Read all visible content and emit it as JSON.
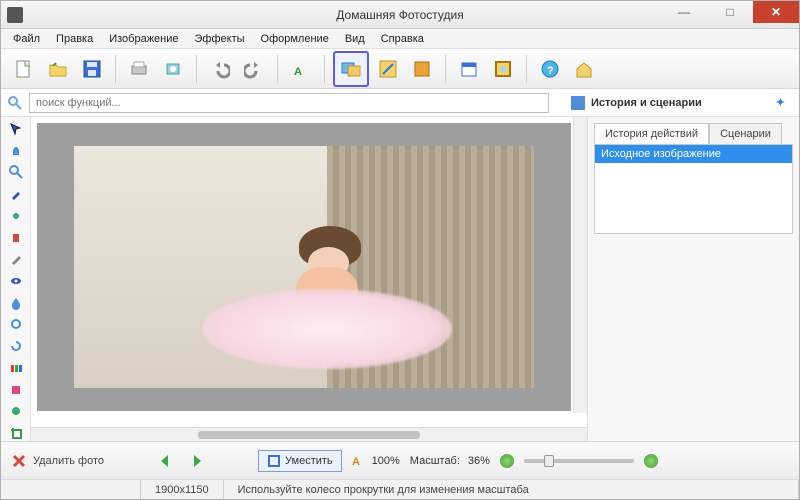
{
  "window": {
    "title": "Домашняя Фотостудия",
    "min": "—",
    "max": "□",
    "close": "✕"
  },
  "menu": [
    "Файл",
    "Правка",
    "Изображение",
    "Эффекты",
    "Оформление",
    "Вид",
    "Справка"
  ],
  "toolbar_icons": [
    "new-file-icon",
    "open-folder-icon",
    "save-icon",
    "print-icon",
    "scan-icon",
    "undo-icon",
    "redo-icon",
    "text-icon",
    "image-compose-icon",
    "resize-icon",
    "crop-icon",
    "calendar-icon",
    "frame-icon",
    "help-icon",
    "home-icon"
  ],
  "search": {
    "placeholder": "поиск функций..."
  },
  "history_panel": {
    "title": "История и сценарии",
    "tabs": [
      "История действий",
      "Сценарии"
    ],
    "active_tab": 0,
    "items": [
      "Исходное изображение"
    ]
  },
  "left_tools": [
    "pointer-icon",
    "hand-icon",
    "zoom-icon",
    "eyedropper-icon",
    "brush-icon",
    "stamp-icon",
    "pencil-icon",
    "eye-icon",
    "blur-icon",
    "dodge-icon",
    "swirl-icon",
    "gradient-icon",
    "effects-icon",
    "healing-icon",
    "crop-tool-icon"
  ],
  "bottom": {
    "delete_label": "Удалить фото",
    "fit_label": "Уместить",
    "scale_prefix": "Масштаб:",
    "scale_value": "36%",
    "zoom_100": "100%"
  },
  "status": {
    "dimensions": "1900x1150",
    "hint": "Используйте колесо прокрутки для изменения масштаба"
  },
  "colors": {
    "accent": "#5f5fd3",
    "selection": "#2e8eea",
    "close": "#c6422e"
  }
}
